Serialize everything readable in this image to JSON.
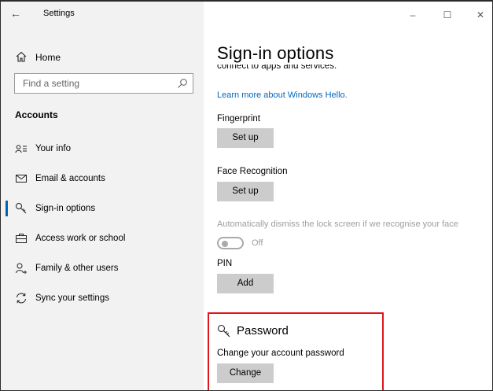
{
  "window": {
    "title": "Settings",
    "controls": {
      "minimize": "–",
      "maximize": "☐",
      "close": "✕"
    }
  },
  "sidebar": {
    "home_label": "Home",
    "search_placeholder": "Find a setting",
    "section_title": "Accounts",
    "items": [
      {
        "label": "Your info",
        "icon": "person-list-icon"
      },
      {
        "label": "Email & accounts",
        "icon": "mail-icon"
      },
      {
        "label": "Sign-in options",
        "icon": "key-icon",
        "selected": true
      },
      {
        "label": "Access work or school",
        "icon": "briefcase-icon"
      },
      {
        "label": "Family & other users",
        "icon": "person-add-icon"
      },
      {
        "label": "Sync your settings",
        "icon": "sync-icon"
      }
    ]
  },
  "main": {
    "title": "Sign-in options",
    "clipped_text": "connect to apps and services.",
    "hello_link": "Learn more about Windows Hello.",
    "fingerprint": {
      "label": "Fingerprint",
      "button": "Set up"
    },
    "face": {
      "label": "Face Recognition",
      "button": "Set up"
    },
    "auto_dismiss": {
      "label": "Automatically dismiss the lock screen if we recognise your face",
      "state": "Off"
    },
    "pin": {
      "label": "PIN",
      "button": "Add"
    },
    "password": {
      "title": "Password",
      "description": "Change your account password",
      "button": "Change"
    }
  },
  "colors": {
    "accent": "#0063b1",
    "link": "#0067c0",
    "highlight": "#e1141e",
    "sidebar_bg": "#f2f2f2",
    "button_bg": "#cccccc"
  }
}
